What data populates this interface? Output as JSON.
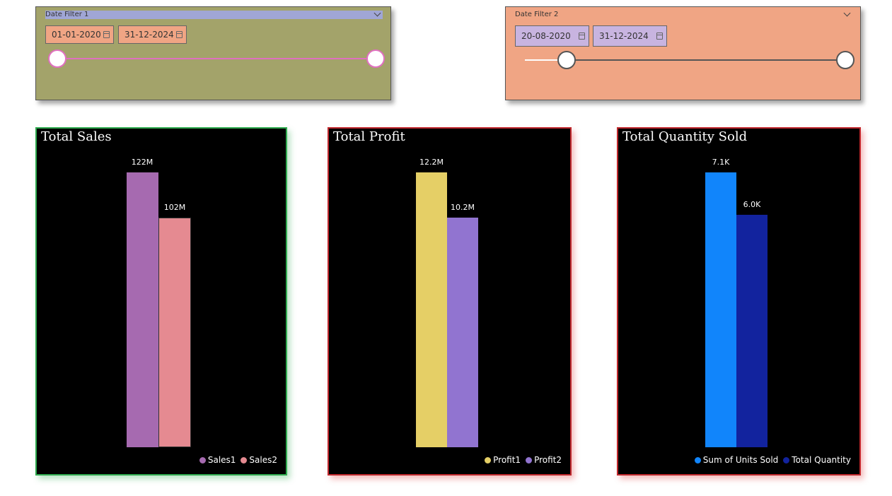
{
  "filters": [
    {
      "title": "Date Filter 1",
      "start_date": "01-01-2020",
      "end_date": "31-12-2024",
      "range_start_fraction": 0.0,
      "range_end_fraction": 1.0,
      "colors": {
        "background": "#a3a36a",
        "datebox": "#f0a584",
        "track": "#e070c0",
        "thumb_border": "#e070c0"
      }
    },
    {
      "title": "Date Filter 2",
      "start_date": "20-08-2020",
      "end_date": "31-12-2024",
      "range_start_fraction": 0.13,
      "range_end_fraction": 1.0,
      "colors": {
        "background": "#f0a584",
        "datebox": "#c8b4e0",
        "track": "#555555",
        "thumb_border": "#555555"
      }
    }
  ],
  "charts": {
    "sales": {
      "title": "Total Sales",
      "border_color": "#2faa4f",
      "glow_color": "rgba(47,170,79,0.35)",
      "legend": [
        "Sales1",
        "Sales2"
      ],
      "colors": [
        "#a66ab0",
        "#e58a91"
      ],
      "labels": [
        "122M",
        "102M"
      ]
    },
    "profit": {
      "title": "Total Profit",
      "border_color": "#c0282d",
      "glow_color": "rgba(220,60,60,0.35)",
      "legend": [
        "Profit1",
        "Profit2"
      ],
      "colors": [
        "#e5cf66",
        "#9174d0"
      ],
      "labels": [
        "12.2M",
        "10.2M"
      ]
    },
    "quantity": {
      "title": "Total Quantity Sold",
      "border_color": "#c0282d",
      "glow_color": "rgba(220,60,60,0.35)",
      "legend": [
        "Sum of Units Sold",
        "Total Quantity"
      ],
      "colors": [
        "#1185fb",
        "#12239e"
      ],
      "labels": [
        "7.1K",
        "6.0K"
      ]
    }
  },
  "chart_data": [
    {
      "type": "bar",
      "title": "Total Sales",
      "categories": [
        ""
      ],
      "series": [
        {
          "name": "Sales1",
          "values": [
            122000000
          ]
        },
        {
          "name": "Sales2",
          "values": [
            102000000
          ]
        }
      ],
      "data_labels": [
        "122M",
        "102M"
      ],
      "xlabel": "",
      "ylabel": "",
      "ylim": [
        0,
        122000000
      ],
      "grid": false,
      "legend_position": "bottom-right"
    },
    {
      "type": "bar",
      "title": "Total Profit",
      "categories": [
        ""
      ],
      "series": [
        {
          "name": "Profit1",
          "values": [
            12200000
          ]
        },
        {
          "name": "Profit2",
          "values": [
            10200000
          ]
        }
      ],
      "data_labels": [
        "12.2M",
        "10.2M"
      ],
      "xlabel": "",
      "ylabel": "",
      "ylim": [
        0,
        12200000
      ],
      "grid": false,
      "legend_position": "bottom-right"
    },
    {
      "type": "bar",
      "title": "Total Quantity Sold",
      "categories": [
        ""
      ],
      "series": [
        {
          "name": "Sum of Units Sold",
          "values": [
            7100
          ]
        },
        {
          "name": "Total Quantity",
          "values": [
            6000
          ]
        }
      ],
      "data_labels": [
        "7.1K",
        "6.0K"
      ],
      "xlabel": "",
      "ylabel": "",
      "ylim": [
        0,
        7100
      ],
      "grid": false,
      "legend_position": "bottom-right"
    }
  ]
}
